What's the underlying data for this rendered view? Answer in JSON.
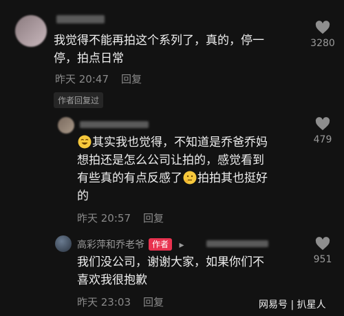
{
  "comments": [
    {
      "text_lines": [
        "我觉得不能再拍这个系列了，真的，停一",
        "停，拍点日常"
      ],
      "time": "昨天 20:47",
      "reply_label": "回复",
      "likes": "3280",
      "chip": "作者回复过"
    },
    {
      "line1": "其实我也觉得，不知道是乔爸乔妈",
      "line2": "想拍还是怎么公司让拍的，感觉看到",
      "line3a": "有些真的有点反感了",
      "line3b": "拍拍其也挺好",
      "line4": "的",
      "time": "昨天 20:57",
      "reply_label": "回复",
      "likes": "479"
    },
    {
      "username": "高彩萍和乔老爷",
      "author_tag": "作者",
      "reply_arrow": "▸",
      "text_lines": [
        "我们没公司，谢谢大家，如果你们不",
        "喜欢我很抱歉"
      ],
      "time": "昨天 23:03",
      "reply_label": "回复",
      "likes": "951"
    }
  ],
  "watermark": "网易号 | 扒星人",
  "icons": [
    "heart-icon",
    "smile-emoji",
    "thinking-emoji"
  ]
}
